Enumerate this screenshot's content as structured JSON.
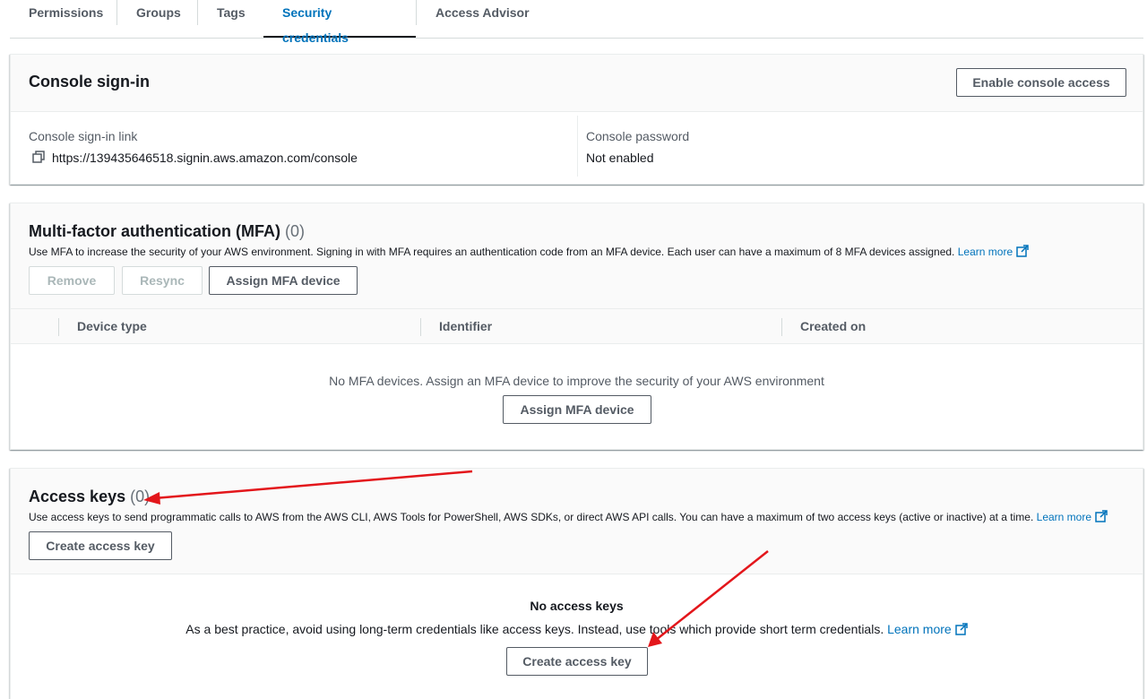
{
  "tabs": [
    {
      "label": "Permissions"
    },
    {
      "label": "Groups"
    },
    {
      "label": "Tags"
    },
    {
      "label": "Security credentials"
    },
    {
      "label": "Access Advisor"
    }
  ],
  "console_signin": {
    "title": "Console sign-in",
    "enable_button": "Enable console access",
    "link_label": "Console sign-in link",
    "link_value": "https://139435646518.signin.aws.amazon.com/console",
    "password_label": "Console password",
    "password_value": "Not enabled"
  },
  "mfa": {
    "title": "Multi-factor authentication (MFA)",
    "count": "(0)",
    "description": "Use MFA to increase the security of your AWS environment. Signing in with MFA requires an authentication code from an MFA device. Each user can have a maximum of 8 MFA devices assigned.",
    "learn_more": "Learn more",
    "remove_button": "Remove",
    "resync_button": "Resync",
    "assign_button": "Assign MFA device",
    "columns": [
      "Device type",
      "Identifier",
      "Created on"
    ],
    "empty_text": "No MFA devices. Assign an MFA device to improve the security of your AWS environment",
    "empty_assign_button": "Assign MFA device"
  },
  "access_keys": {
    "title": "Access keys",
    "count": "(0)",
    "description": "Use access keys to send programmatic calls to AWS from the AWS CLI, AWS Tools for PowerShell, AWS SDKs, or direct AWS API calls. You can have a maximum of two access keys (active or inactive) at a time.",
    "learn_more": "Learn more",
    "create_button": "Create access key",
    "empty_title": "No access keys",
    "empty_text": "As a best practice, avoid using long-term credentials like access keys. Instead, use tools which provide short term credentials.",
    "empty_learn_more": "Learn more",
    "empty_create_button": "Create access key"
  },
  "colors": {
    "link": "#0073bb",
    "annotation_arrow": "#e3161b"
  },
  "icons": {
    "copy": "copy-icon",
    "external_link": "external-link-icon"
  }
}
